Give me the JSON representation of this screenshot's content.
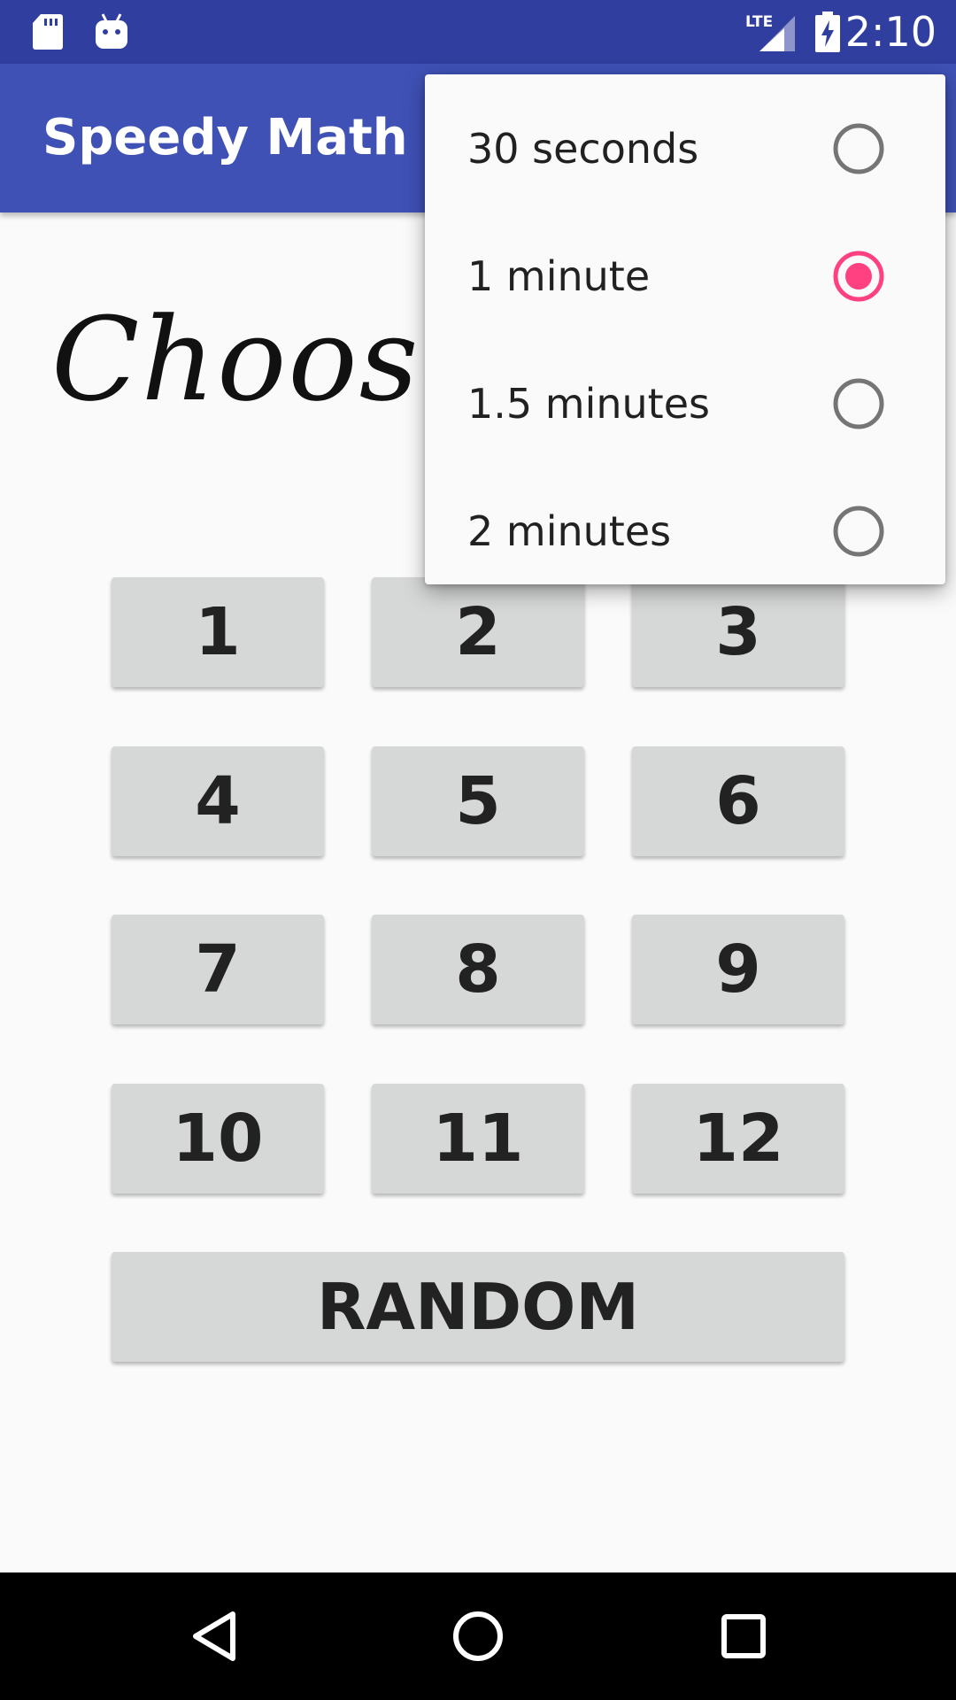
{
  "status_bar": {
    "time": "2:10",
    "network_label": "LTE",
    "icons": [
      "sd-card-icon",
      "android-debug-icon",
      "lte-signal-icon",
      "battery-charging-icon"
    ]
  },
  "app_bar": {
    "title": "Speedy Math",
    "color": "#3f51b5",
    "status_color": "#303f9f"
  },
  "main": {
    "heading": "Choose",
    "number_buttons": [
      "1",
      "2",
      "3",
      "4",
      "5",
      "6",
      "7",
      "8",
      "9",
      "10",
      "11",
      "12"
    ],
    "random_label": "RANDOM"
  },
  "time_menu": {
    "selected": "1 minute",
    "accent": "#ff4081",
    "options": [
      {
        "label": "30 seconds",
        "checked": false
      },
      {
        "label": "1 minute",
        "checked": true
      },
      {
        "label": "1.5 minutes",
        "checked": false
      },
      {
        "label": "2 minutes",
        "checked": false
      }
    ]
  },
  "nav_bar": {
    "icons": [
      "back-icon",
      "home-icon",
      "recents-icon"
    ]
  }
}
